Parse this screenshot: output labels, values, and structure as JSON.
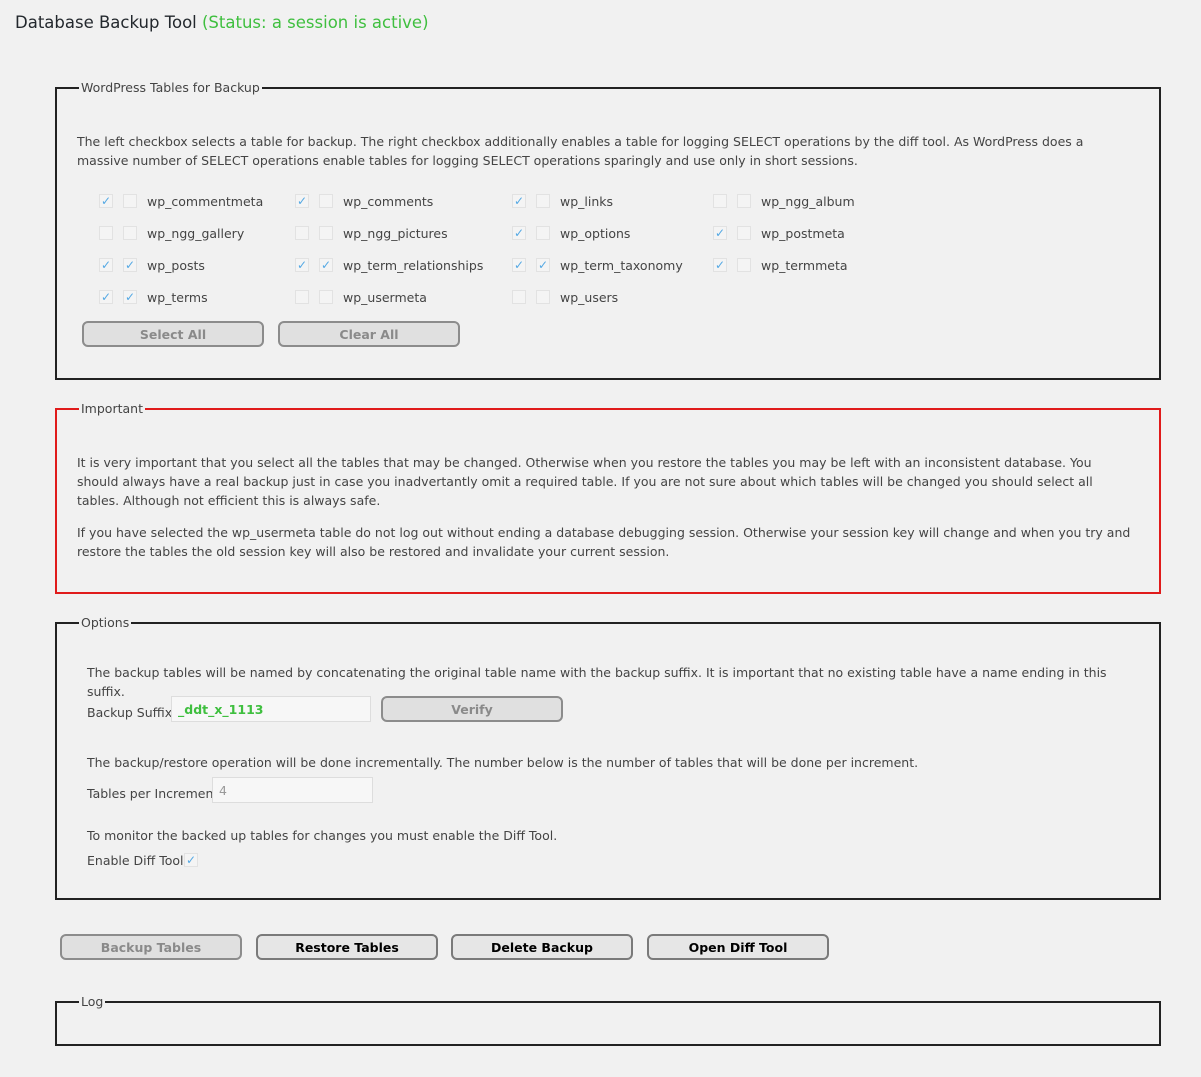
{
  "header": {
    "title": "Database Backup Tool",
    "status": "(Status: a session is active)"
  },
  "tables_section": {
    "legend": "WordPress Tables for Backup",
    "description": "The left checkbox selects a table for backup. The right checkbox additionally enables a table for logging SELECT operations by the diff tool. As WordPress does a massive number of SELECT operations enable tables for logging SELECT operations sparingly and use only in short sessions.",
    "tables": [
      {
        "name": "wp_commentmeta",
        "backup": true,
        "log": false
      },
      {
        "name": "wp_comments",
        "backup": true,
        "log": false
      },
      {
        "name": "wp_links",
        "backup": true,
        "log": false
      },
      {
        "name": "wp_ngg_album",
        "backup": false,
        "log": false
      },
      {
        "name": "wp_ngg_gallery",
        "backup": false,
        "log": false
      },
      {
        "name": "wp_ngg_pictures",
        "backup": false,
        "log": false
      },
      {
        "name": "wp_options",
        "backup": true,
        "log": false
      },
      {
        "name": "wp_postmeta",
        "backup": true,
        "log": false
      },
      {
        "name": "wp_posts",
        "backup": true,
        "log": true
      },
      {
        "name": "wp_term_relationships",
        "backup": true,
        "log": true
      },
      {
        "name": "wp_term_taxonomy",
        "backup": true,
        "log": true
      },
      {
        "name": "wp_termmeta",
        "backup": true,
        "log": false
      },
      {
        "name": "wp_terms",
        "backup": true,
        "log": true
      },
      {
        "name": "wp_usermeta",
        "backup": false,
        "log": false
      },
      {
        "name": "wp_users",
        "backup": false,
        "log": false
      }
    ],
    "select_all_label": "Select All",
    "clear_all_label": "Clear All"
  },
  "important_section": {
    "legend": "Important",
    "paragraph1": "It is very important that you select all the tables that may be changed. Otherwise when you restore the tables you may be left with an inconsistent database. You should always have a real backup just in case you inadvertantly omit a required table. If you are not sure about which tables will be changed you should select all tables. Although not efficient this is always safe.",
    "paragraph2": "If you have selected the wp_usermeta table do not log out without ending a database debugging session. Otherwise your session key will change and when you try and restore the tables the old session key will also be restored and invalidate your current session."
  },
  "options_section": {
    "legend": "Options",
    "suffix_description": "The backup tables will be named by concatenating the original table name with the backup suffix. It is important that no existing table have a name ending in this suffix.",
    "suffix_label": "Backup Suffix:",
    "suffix_value": "_ddt_x_1113",
    "verify_label": "Verify",
    "increment_description": "The backup/restore operation will be done incrementally. The number below is the number of tables that will be done per increment.",
    "increment_label": "Tables per Increment:",
    "increment_value": "4",
    "diff_description": "To monitor the backed up tables for changes you must enable the Diff Tool.",
    "diff_label": "Enable Diff Tool:",
    "diff_enabled": true
  },
  "actions": {
    "backup_label": "Backup Tables",
    "restore_label": "Restore Tables",
    "delete_label": "Delete Backup",
    "diff_tool_label": "Open Diff Tool"
  },
  "log_section": {
    "legend": "Log"
  },
  "colors": {
    "status_green": "#3fbf3f",
    "important_red": "#e01b1b",
    "checkmark_blue": "#55a9e4"
  }
}
